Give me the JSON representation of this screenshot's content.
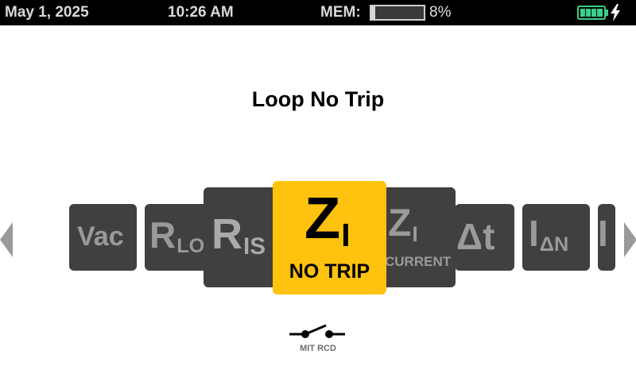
{
  "status": {
    "date": "May 1, 2025",
    "time": "10:26 AM",
    "mem_label": "MEM:",
    "mem_percent_text": "8%",
    "mem_fraction": 0.08,
    "battery_icon": "battery-full-charging-icon"
  },
  "title": "Loop No Trip",
  "carousel": {
    "tiles": [
      {
        "id": "vac",
        "main": "Vac",
        "sub": ""
      },
      {
        "id": "rlo",
        "main": "R",
        "sub": "LO"
      },
      {
        "id": "ris",
        "main": "R",
        "sub": "IS"
      },
      {
        "id": "zi-no-trip",
        "main": "Z",
        "sub": "I",
        "caption": "NO TRIP",
        "selected": true
      },
      {
        "id": "zi-current",
        "main": "Z",
        "sub": "I",
        "caption": "CURRENT"
      },
      {
        "id": "dt",
        "main": "Δt",
        "sub": ""
      },
      {
        "id": "idn",
        "main": "I",
        "sub": "ΔN"
      },
      {
        "id": "next",
        "main": "I",
        "sub": ""
      }
    ],
    "left_arrow_icon": "chevron-left-icon",
    "right_arrow_icon": "chevron-right-icon"
  },
  "mode": {
    "icon": "switch-icon",
    "label": "MIT RCD"
  },
  "colors": {
    "accent": "#ffc20e",
    "tile_bg": "#404040",
    "tile_text": "#9a9a9a",
    "battery": "#3ad08a"
  }
}
